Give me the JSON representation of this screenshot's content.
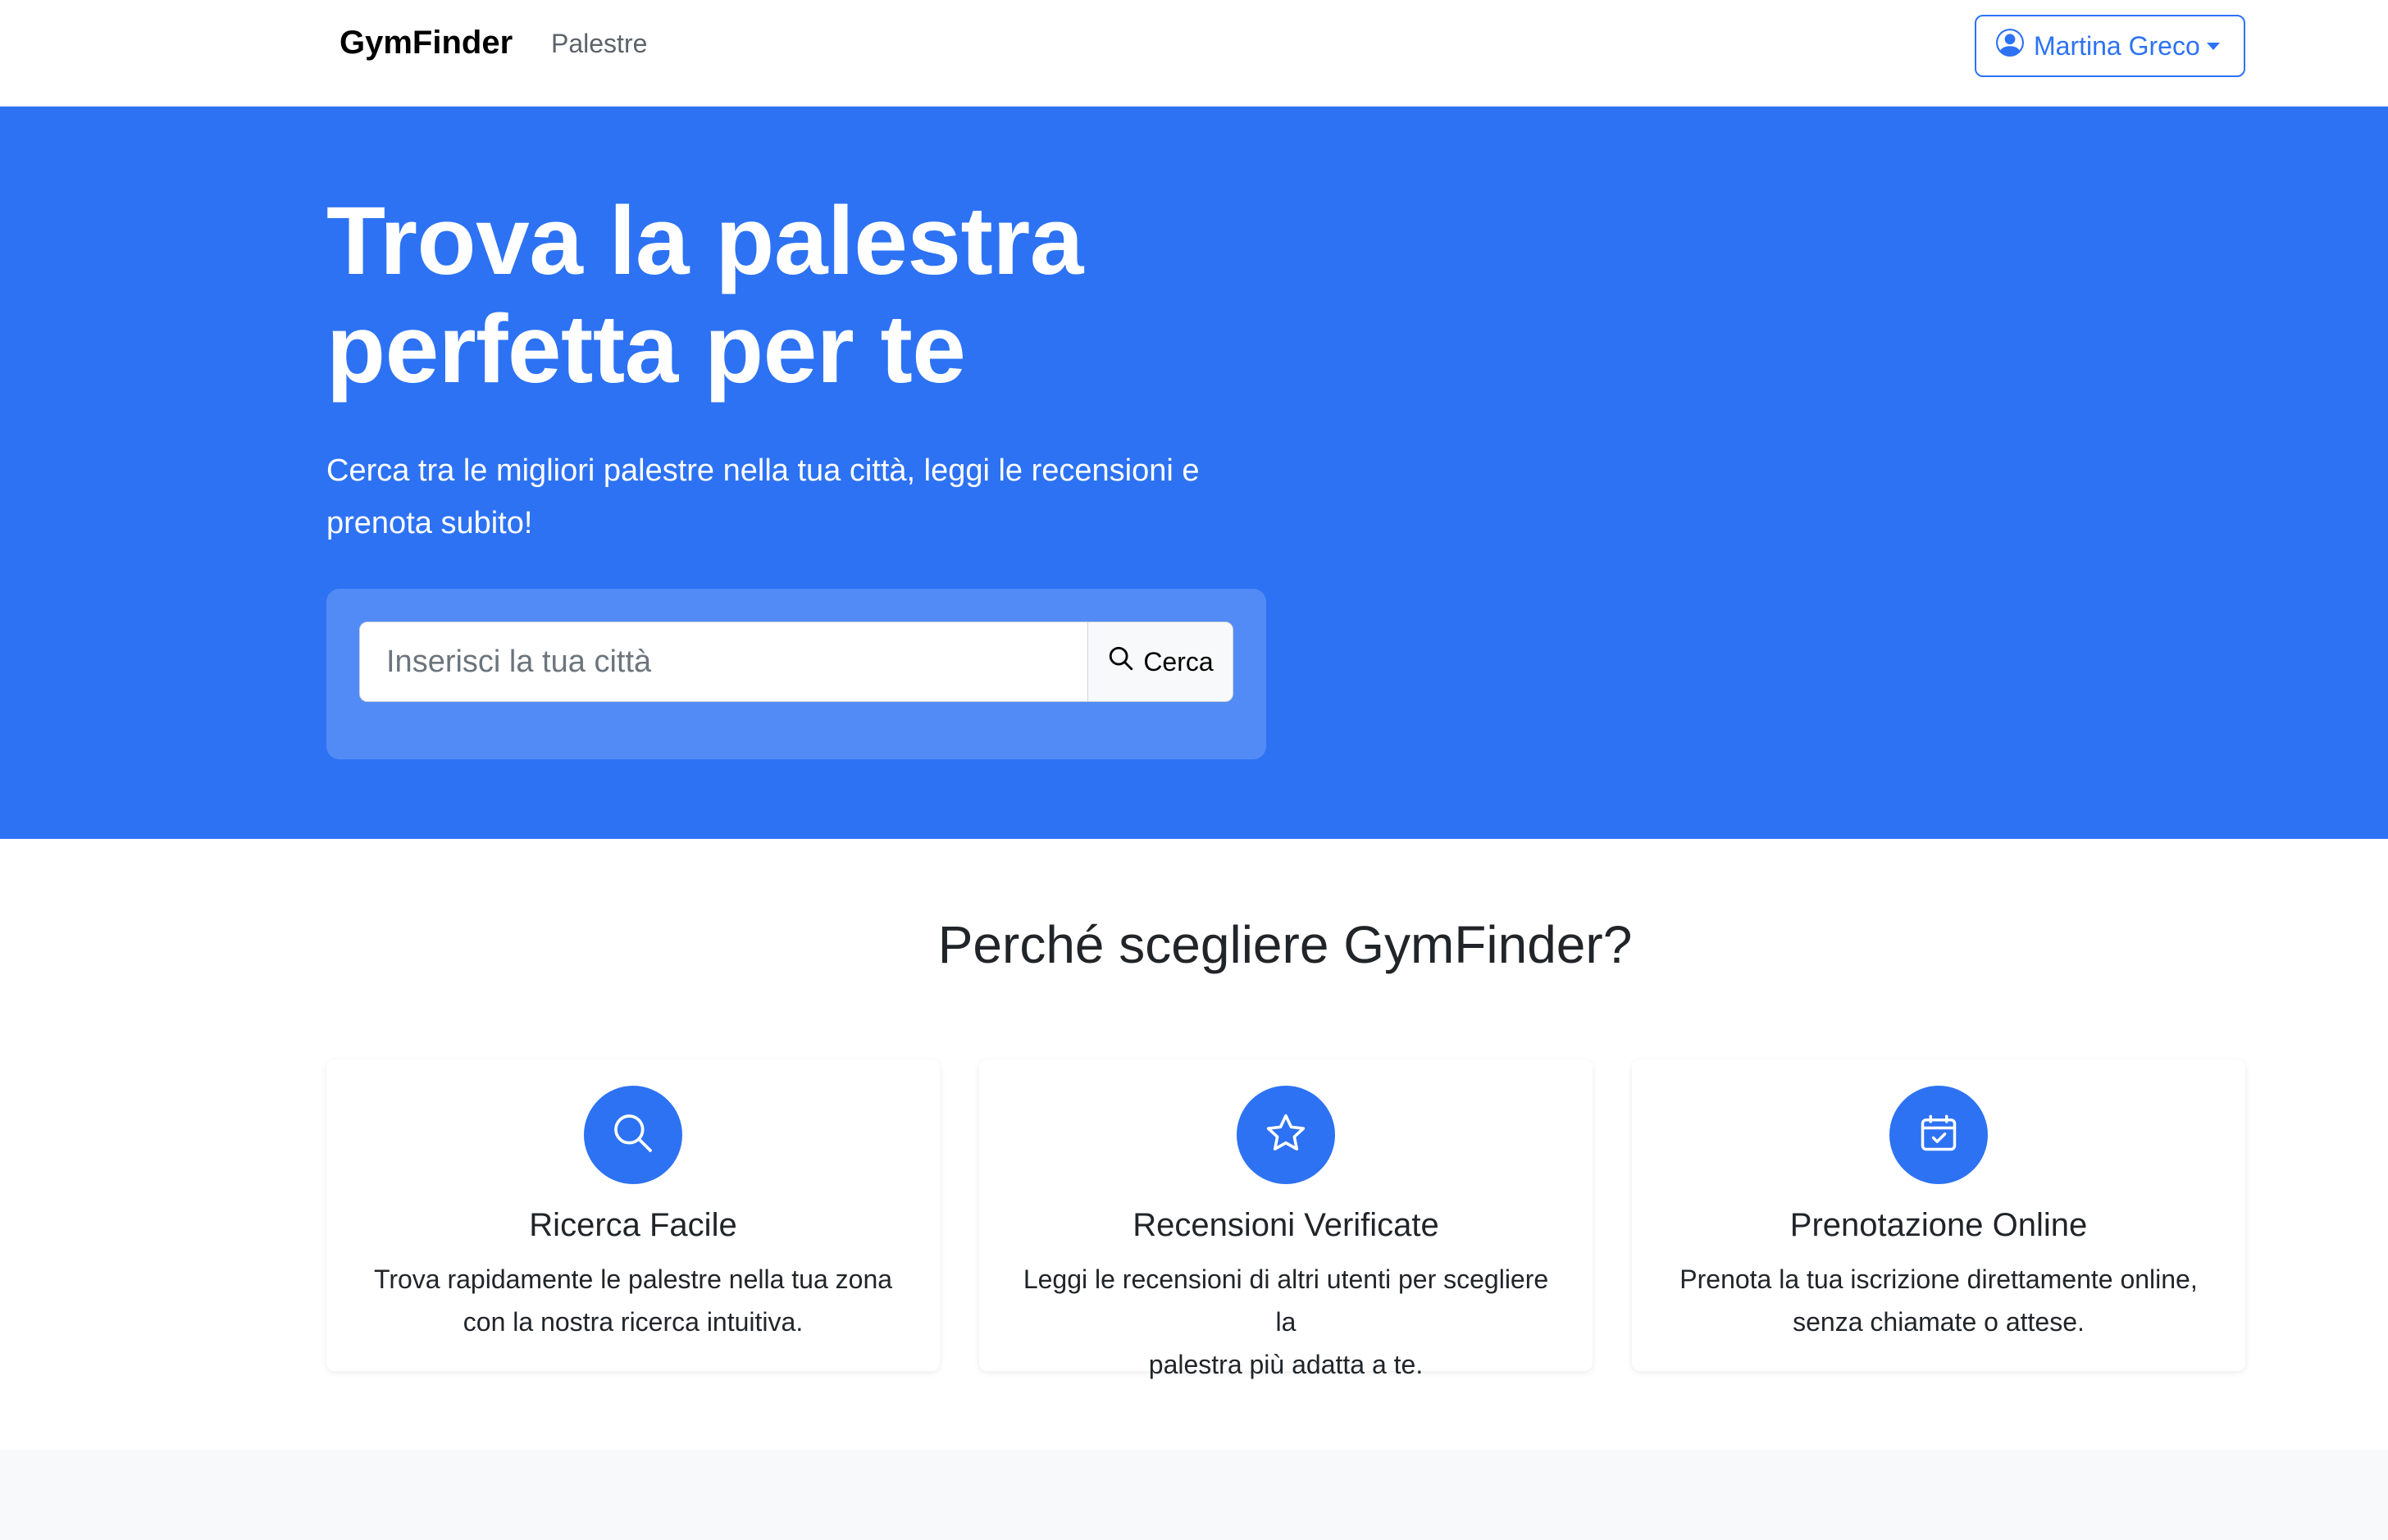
{
  "nav": {
    "brand": "GymFinder",
    "links": [
      "Palestre"
    ],
    "user_name": "Martina Greco"
  },
  "hero": {
    "title_line1": "Trova la palestra",
    "title_line2": "perfetta per te",
    "subtitle_line1": "Cerca tra le migliori palestre nella tua città, leggi le recensioni e",
    "subtitle_line2": "prenota subito!",
    "search_placeholder": "Inserisci la tua città",
    "search_button": "Cerca"
  },
  "features": {
    "title": "Perché scegliere GymFinder?",
    "items": [
      {
        "icon": "search-icon",
        "title": "Ricerca Facile",
        "line1": "Trova rapidamente le palestre nella tua zona",
        "line2": "con la nostra ricerca intuitiva."
      },
      {
        "icon": "star-icon",
        "title": "Recensioni Verificate",
        "line1": "Leggi le recensioni di altri utenti per scegliere la",
        "line2": "palestra più adatta a te."
      },
      {
        "icon": "calendar-check-icon",
        "title": "Prenotazione Online",
        "line1": "Prenota la tua iscrizione direttamente online,",
        "line2": "senza chiamate o attese."
      }
    ]
  },
  "colors": {
    "primary": "#2d72f3",
    "light_bg": "#f8f9fa"
  }
}
